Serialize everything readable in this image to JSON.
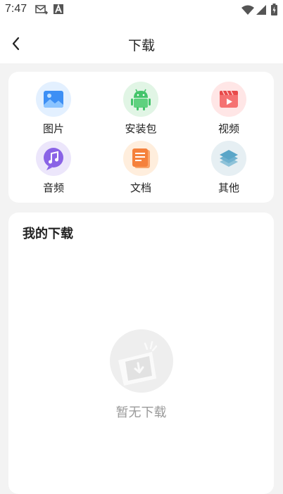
{
  "status_bar": {
    "time": "7:47",
    "icons": [
      "email-forward-icon",
      "font-a-icon",
      "wifi-icon",
      "signal-icon",
      "battery-charging-icon"
    ]
  },
  "header": {
    "title": "下载",
    "back_icon": "back-arrow-icon"
  },
  "categories": [
    {
      "label": "图片",
      "icon": "image-icon",
      "color": "#3d8ff5"
    },
    {
      "label": "安装包",
      "icon": "android-icon",
      "color": "#43c46a"
    },
    {
      "label": "视频",
      "icon": "video-icon",
      "color": "#f05a5a"
    },
    {
      "label": "音频",
      "icon": "music-icon",
      "color": "#8a63e6"
    },
    {
      "label": "文档",
      "icon": "document-icon",
      "color": "#f5813c"
    },
    {
      "label": "其他",
      "icon": "layers-icon",
      "color": "#5aa6c8"
    }
  ],
  "downloads": {
    "title": "我的下载",
    "empty_text": "暂无下载",
    "empty_icon": "empty-download-icon"
  }
}
